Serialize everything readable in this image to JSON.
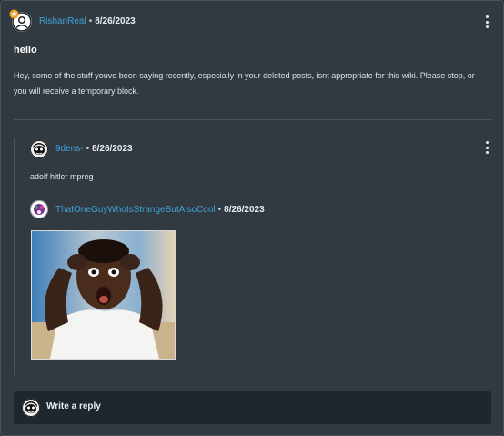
{
  "post": {
    "author": "RishanReal",
    "separator": "•",
    "date": "8/26/2023",
    "title": "hello",
    "body": "Hey, some of the stuff youve been saying recently, especially in your deleted posts, isnt appropriate for this wiki. Please stop, or you will receive a temporary block."
  },
  "replies": [
    {
      "author": "9dens-",
      "separator": "•",
      "date": "8/26/2023",
      "text": "adolf hitler mpreg"
    },
    {
      "author": "ThatOneGuyWhoIsStrangeButAlsoCool",
      "separator": "•",
      "date": "8/26/2023",
      "image": "shocked-man-reaction-photo"
    }
  ],
  "composer": {
    "placeholder": "Write a reply"
  },
  "icons": {
    "post_avatar": "default-user-icon",
    "badge": "staff-star-badge-icon",
    "reply1_avatar": "cartoon-avatar-icon",
    "reply2_avatar": "colorful-avatar-icon",
    "menu": "kebab-menu-icon"
  },
  "colors": {
    "background": "#313a41",
    "username": "#3fa2d9",
    "composer": "#1e272d"
  }
}
